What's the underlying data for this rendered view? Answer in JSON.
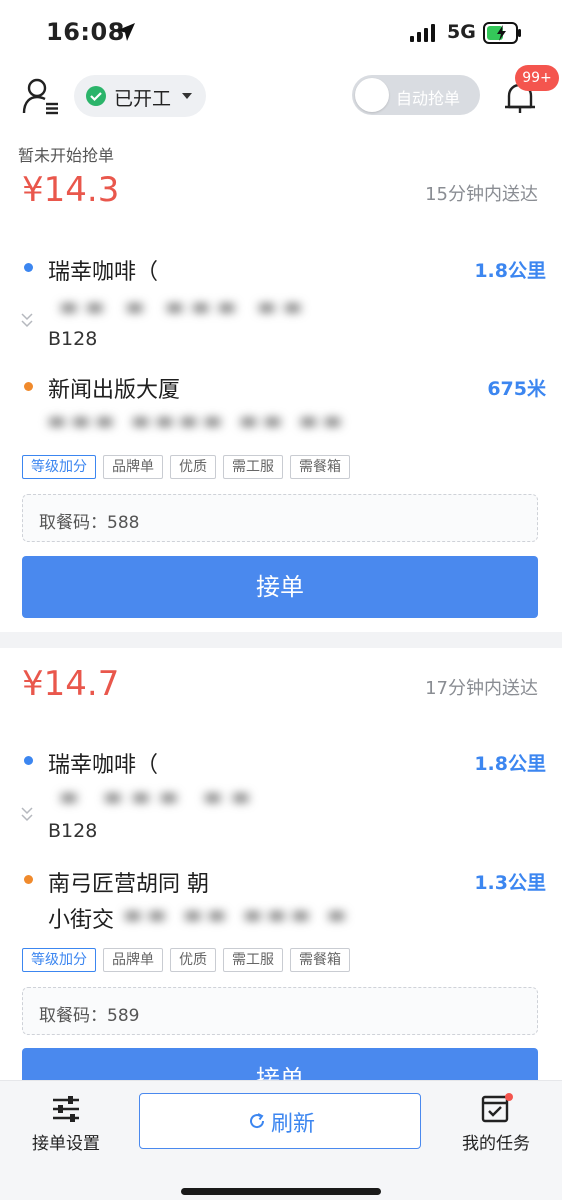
{
  "status_bar": {
    "time": "16:08",
    "network": "5G"
  },
  "header": {
    "shift_status": "已开工",
    "auto_grab_label": "自动抢单",
    "notification_badge": "99+"
  },
  "orders": [
    {
      "hint": "暂未开始抢单",
      "price": "¥14.3",
      "eta": "15分钟内送达",
      "pickup": {
        "name": "瑞幸咖啡（",
        "detail": "B128",
        "distance": "1.8公里"
      },
      "dropoff": {
        "name": "新闻出版大厦",
        "detail": "",
        "distance": "675米"
      },
      "tags": [
        "等级加分",
        "品牌单",
        "优质",
        "需工服",
        "需餐箱"
      ],
      "code_label": "取餐码：588",
      "accept_label": "接单"
    },
    {
      "hint": "",
      "price": "¥14.7",
      "eta": "17分钟内送达",
      "pickup": {
        "name": "瑞幸咖啡（",
        "detail": "B128",
        "distance": "1.8公里"
      },
      "dropoff": {
        "name": "南弓匠营胡同 朝",
        "detail": "小街交",
        "distance": "1.3公里"
      },
      "tags": [
        "等级加分",
        "品牌单",
        "优质",
        "需工服",
        "需餐箱"
      ],
      "code_label": "取餐码：589",
      "accept_label": "接单"
    }
  ],
  "bottom_nav": {
    "settings_label": "接单设置",
    "refresh_label": "刷新",
    "tasks_label": "我的任务"
  },
  "colors": {
    "accent": "#4a89ee",
    "price": "#e9574c",
    "badge": "#f4554e",
    "online": "#2bb46a"
  }
}
